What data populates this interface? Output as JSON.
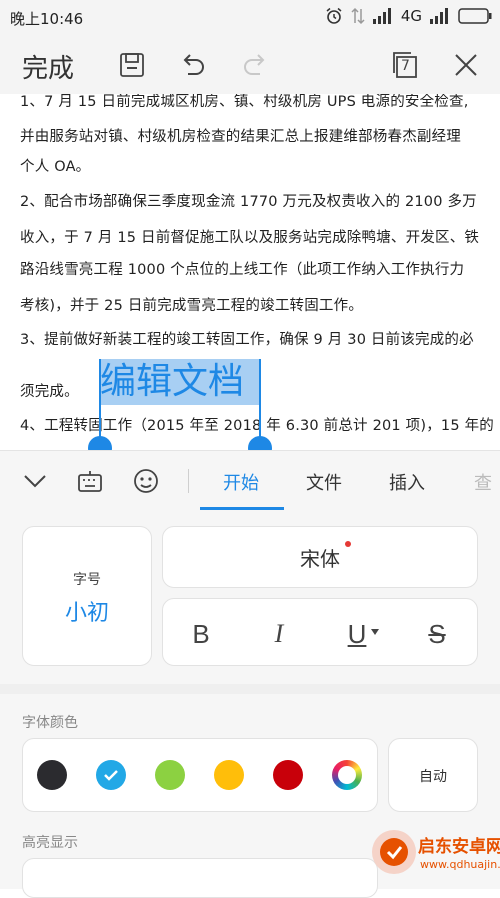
{
  "status_bar": {
    "time": "晚上10:46",
    "network": "4G"
  },
  "toolbar": {
    "done_label": "完成",
    "page_count": "7",
    "icons": [
      "save-icon",
      "undo-icon",
      "redo-icon",
      "pages-icon",
      "close-icon"
    ]
  },
  "document": {
    "lines": [
      "1、7 月 15 日前完成城区机房、镇、村级机房 UPS 电源的安全检查,",
      "并由服务站对镇、村级机房检查的结果汇总上报建维部杨春杰副经理",
      "个人 OA。",
      "2、配合市场部确保三季度现金流 1770 万元及权责收入的 2100 多万",
      "收入，于 7 月 15 日前督促施工队以及服务站完成除鸭塘、开发区、铁",
      "路沿线雪亮工程 1000 个点位的上线工作（此项工作纳入工作执行力",
      "考核)，并于 25 日前完成雪亮工程的竣工转固工作。",
      "3、提前做好新装工程的竣工转固工作，确保 9 月 30 日前该完成的必",
      "须完成。",
      "4、工程转固工作（2015 年至 2018 年 6.30 前总计 201 项)，15 年的"
    ],
    "selected_text": "编辑文档"
  },
  "format_tabs": {
    "items": [
      "开始",
      "文件",
      "插入",
      "查"
    ],
    "active": "开始",
    "icons": [
      "collapse-chevron-icon",
      "keyboard-icon",
      "sticker-icon"
    ]
  },
  "font": {
    "size_label": "字号",
    "size_value": "小初",
    "font_name": "宋体",
    "styles": [
      "B",
      "I",
      "U",
      "S"
    ]
  },
  "font_color": {
    "label": "字体颜色",
    "swatches": [
      "#2b2b2f",
      "#22a8e6",
      "#8cd141",
      "#ffbe0a",
      "#c8000a",
      "multicolor"
    ],
    "selected": "#22a8e6",
    "auto_label": "自动"
  },
  "highlight": {
    "label": "高亮显示"
  },
  "watermark": {
    "title": "启东安卓网",
    "url": "www.qdhuajin.com"
  }
}
